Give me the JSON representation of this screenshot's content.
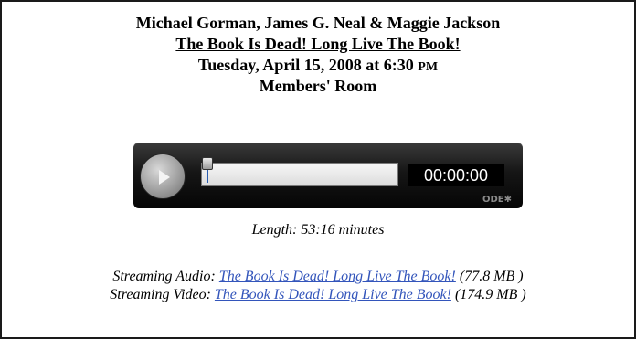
{
  "event": {
    "speakers": "Michael Gorman, James G. Neal & Maggie Jackson",
    "title": "The Book Is Dead! Long Live The Book!",
    "date_main": "Tuesday, April 15, 2008 at 6:30 ",
    "date_suffix": "PM",
    "location": "Members' Room"
  },
  "player": {
    "time": "00:00:00",
    "progress": 0,
    "logo": "ODE✱"
  },
  "length": "Length: 53:16 minutes",
  "streaming": [
    {
      "label": "Streaming Audio: ",
      "link": "The Book Is Dead! Long Live The Book!",
      "size": " (77.8 MB )"
    },
    {
      "label": "Streaming Video: ",
      "link": "The Book Is Dead! Long Live The Book!",
      "size": " (174.9 MB )"
    }
  ]
}
